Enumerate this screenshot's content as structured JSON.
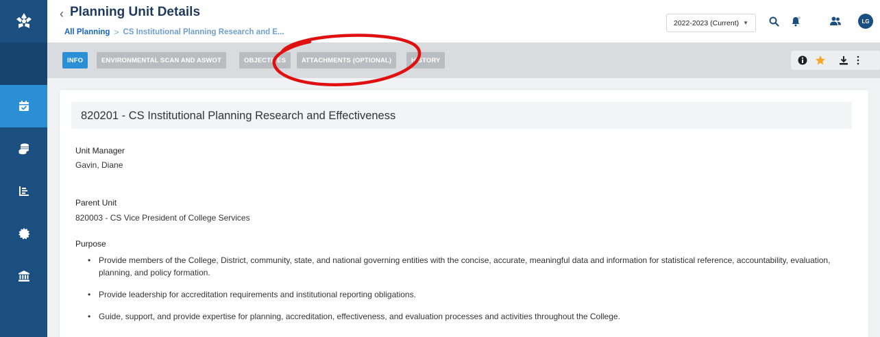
{
  "header": {
    "title": "Planning Unit Details",
    "back_icon": "chevron-left-icon",
    "breadcrumb": {
      "root": "All Planning",
      "separator": ">",
      "current": "CS Institutional Planning Research and E..."
    },
    "year_select": {
      "value": "2022-2023 (Current)"
    },
    "icons": [
      "search-icon",
      "bell-icon",
      "users-icon"
    ],
    "avatar_initials": "LG"
  },
  "sidebar": {
    "items": [
      {
        "name": "calendar-check-icon",
        "active": true
      },
      {
        "name": "coins-icon",
        "active": false
      },
      {
        "name": "bar-list-icon",
        "active": false
      },
      {
        "name": "gear-icon",
        "active": false
      },
      {
        "name": "institution-icon",
        "active": false
      }
    ]
  },
  "tabs": [
    {
      "label": "INFO",
      "active": true
    },
    {
      "label": "ENVIRONMENTAL SCAN AND ASWOT",
      "active": false
    },
    {
      "label": "OBJECTIVES",
      "active": false
    },
    {
      "label": "ATTACHMENTS (OPTIONAL)",
      "active": false
    },
    {
      "label": "HISTORY",
      "active": false
    }
  ],
  "toolbar": {
    "icons": [
      "info-icon",
      "star-icon",
      "download-icon",
      "more-vertical-icon"
    ]
  },
  "unit": {
    "title": "820201 - CS Institutional Planning Research and Effectiveness",
    "manager_label": "Unit Manager",
    "manager_value": "Gavin, Diane",
    "parent_label": "Parent Unit",
    "parent_value": "820003 - CS Vice President of College Services",
    "purpose_label": "Purpose",
    "purpose_items": [
      "Provide members of the College, District, community, state, and national governing entities with the concise, accurate, meaningful data and information for statistical reference, accountability, evaluation, planning, and policy formation.",
      "Provide leadership for accreditation requirements and institutional reporting obligations.",
      "Guide, support, and provide expertise for planning, accreditation, effectiveness, and evaluation processes and activities throughout the College."
    ]
  },
  "colors": {
    "sidebar": "#1a4f80",
    "accent": "#2b8fd6",
    "tab_inactive": "#b9bcc0",
    "annotation": "#e01010",
    "star": "#f5a623"
  }
}
